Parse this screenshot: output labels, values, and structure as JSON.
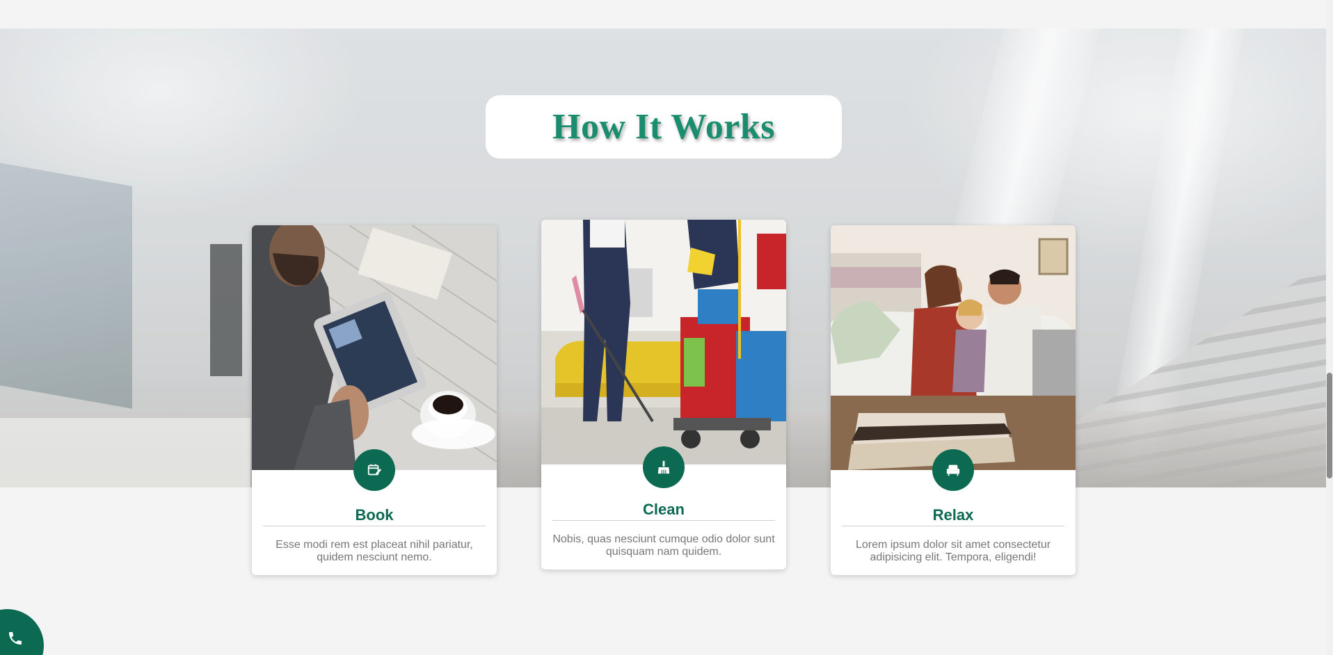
{
  "section": {
    "title": "How It Works"
  },
  "steps": [
    {
      "title": "Book",
      "text": "Esse modi rem est placeat nihil pariatur, quidem nesciunt nemo.",
      "icon": "calendar-edit-icon",
      "image": "man-using-tablet-photo"
    },
    {
      "title": "Clean",
      "text": "Nobis, quas nesciunt cumque odio dolor sunt quisquam nam quidem.",
      "icon": "broom-icon",
      "image": "cleaners-with-cart-photo"
    },
    {
      "title": "Relax",
      "text": "Lorem ipsum dolor sit amet consectetur adipisicing elit. Tempora, eligendi!",
      "icon": "armchair-icon",
      "image": "family-on-sofa-photo"
    }
  ],
  "floating": {
    "phone_icon": "phone-icon"
  },
  "colors": {
    "brand": "#0d6a52",
    "title": "#1a8d6e",
    "text_muted": "#777777",
    "page_bg": "#f4f4f4"
  }
}
